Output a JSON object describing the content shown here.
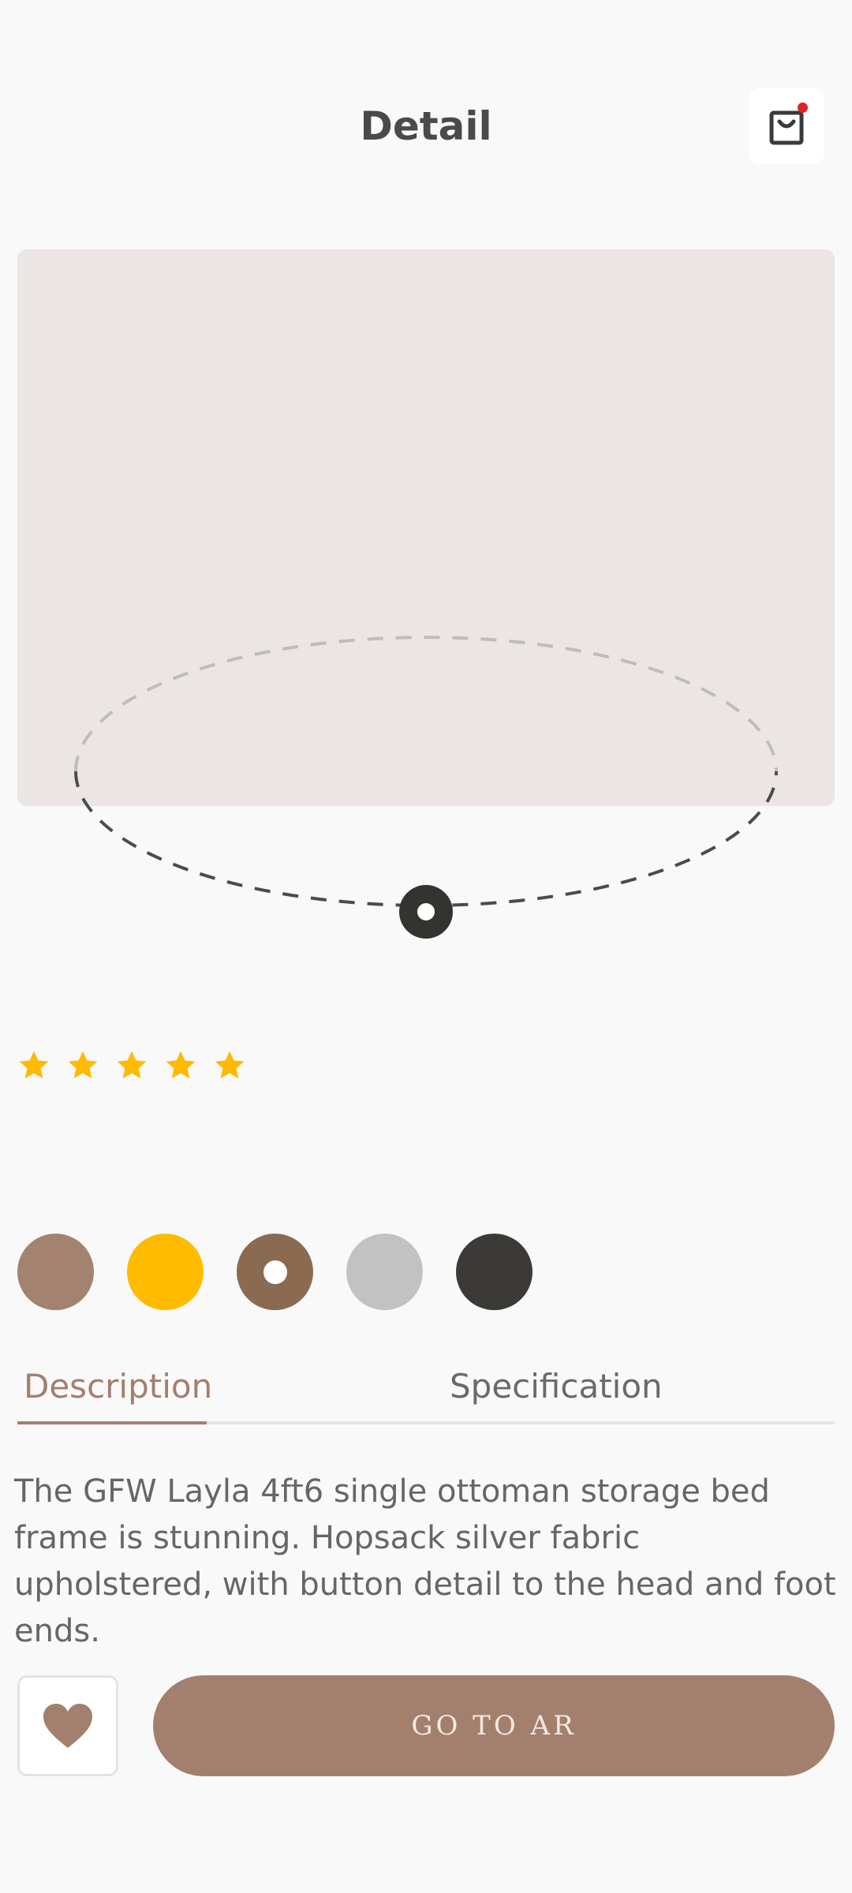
{
  "header": {
    "title": "Detail",
    "cart_icon": "shopping-bag-icon",
    "badge_color": "#e02424"
  },
  "product": {
    "rating": 5,
    "rating_max": 5,
    "star_color": "#ffb900",
    "swatches": [
      {
        "color": "#a3826f",
        "selected": false
      },
      {
        "color": "#ffbb00",
        "selected": false
      },
      {
        "color": "#8a6a51",
        "selected": true
      },
      {
        "color": "#c2c2c2",
        "selected": false
      },
      {
        "color": "#3b3a36",
        "selected": false
      }
    ]
  },
  "tabs": {
    "items": [
      {
        "label": "Description",
        "active": true
      },
      {
        "label": "Specification",
        "active": false
      }
    ]
  },
  "description": "The GFW Layla 4ft6 single ottoman storage bed frame is stunning. Hopsack silver fabric upholstered, with button detail to the head and foot ends.",
  "actions": {
    "favorite_icon": "heart-icon",
    "ar_button_label": "GO TO AR",
    "accent_color": "#a3806e"
  }
}
